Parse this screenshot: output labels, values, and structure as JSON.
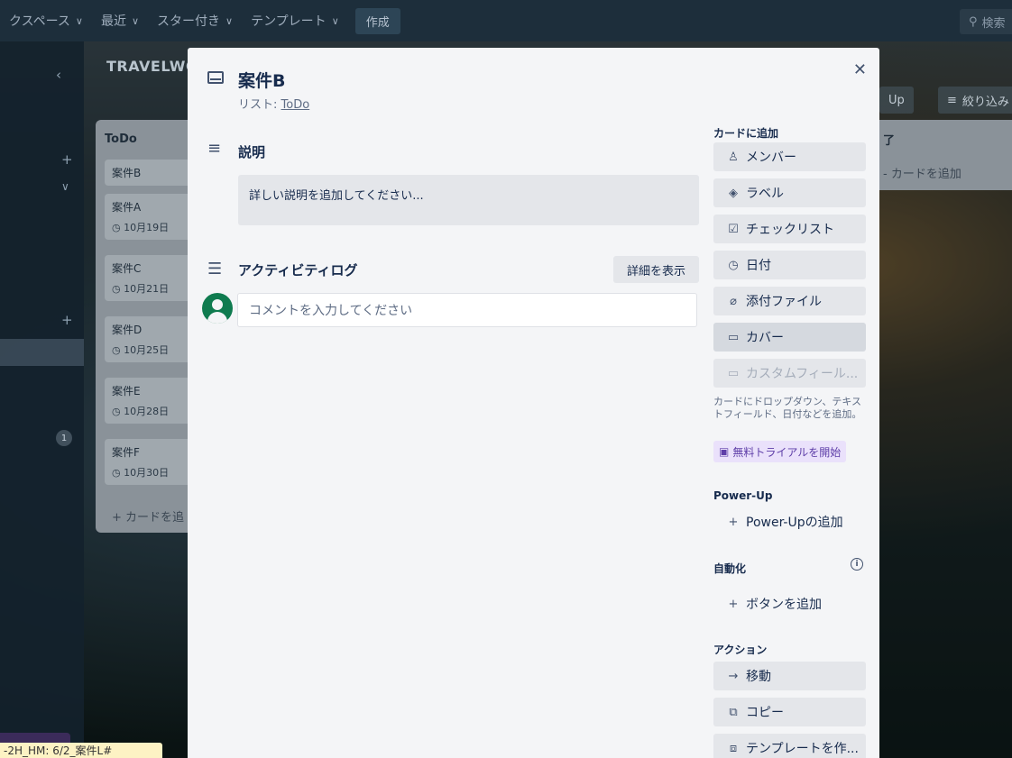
{
  "topnav": {
    "workspaces": "クスペース",
    "recent": "最近",
    "starred": "スター付き",
    "templates": "テンプレート",
    "create": "作成",
    "search": "検索"
  },
  "board": {
    "title": "TRAVELWO",
    "right_buttons": [
      "Up",
      "絞り込み"
    ]
  },
  "list_todo": {
    "title": "ToDo",
    "cards": [
      {
        "title": "案件B",
        "date": ""
      },
      {
        "title": "案件A",
        "date": "10月19日"
      },
      {
        "title": "案件C",
        "date": "10月21日"
      },
      {
        "title": "案件D",
        "date": "10月25日"
      },
      {
        "title": "案件E",
        "date": "10月28日"
      },
      {
        "title": "案件F",
        "date": "10月30日"
      }
    ],
    "add_card": "+ カードを追"
  },
  "list_done": {
    "title": "了",
    "add_card": "- カードを追加"
  },
  "sidebar": {
    "badge": "1"
  },
  "bottom_note": "-2H_HM: 6/2_案件L#",
  "modal": {
    "title": "案件B",
    "list_prefix": "リスト: ",
    "list_name": "ToDo",
    "description_heading": "説明",
    "description_placeholder": "詳しい説明を追加してください...",
    "activity_heading": "アクティビティログ",
    "show_details": "詳細を表示",
    "comment_placeholder": "コメントを入力してください"
  },
  "right_panel": {
    "add_to_card": "カードに追加",
    "members": "メンバー",
    "labels": "ラベル",
    "checklist": "チェックリスト",
    "dates": "日付",
    "attachment": "添付ファイル",
    "cover": "カバー",
    "custom_fields": "カスタムフィール...",
    "custom_note": "カードにドロップダウン、テキストフィールド、日付などを追加。",
    "trial": "無料トライアルを開始",
    "powerups_heading": "Power-Up",
    "add_powerup": "Power-Upの追加",
    "automation_heading": "自動化",
    "add_button": "ボタンを追加",
    "actions_heading": "アクション",
    "move": "移動",
    "copy": "コピー",
    "make_template": "テンプレートを作..."
  }
}
